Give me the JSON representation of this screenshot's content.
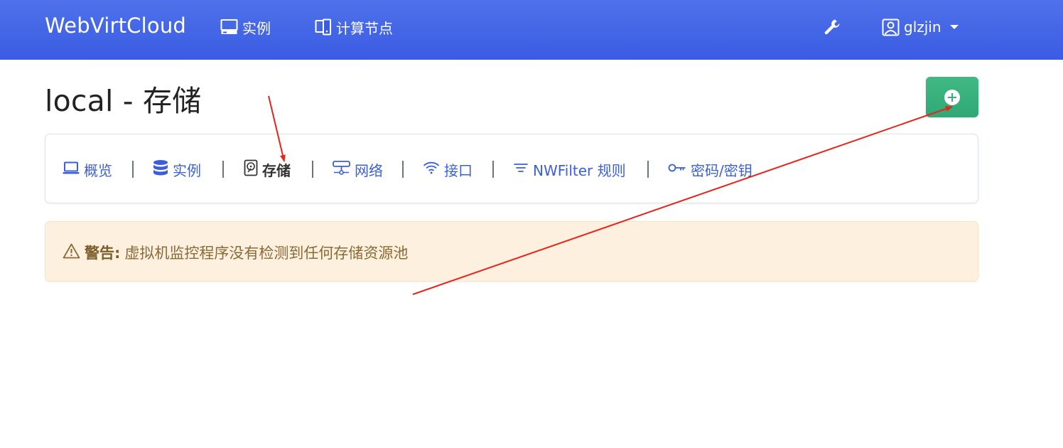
{
  "navbar": {
    "brand": "WebVirtCloud",
    "instances_label": "实例",
    "nodes_label": "计算节点",
    "settings_icon": "wrench-icon",
    "user_name": "glzjin"
  },
  "page": {
    "title": "local - 存储"
  },
  "tabs": [
    {
      "label": "概览",
      "icon": "laptop-icon"
    },
    {
      "label": "实例",
      "icon": "database-icon"
    },
    {
      "label": "存储",
      "icon": "hdd-icon",
      "active": true
    },
    {
      "label": "网络",
      "icon": "network-icon"
    },
    {
      "label": "接口",
      "icon": "wifi-icon"
    },
    {
      "label": "NWFilter 规则",
      "icon": "filter-icon"
    },
    {
      "label": "密码/密钥",
      "icon": "key-icon"
    }
  ],
  "alert": {
    "strong": "警告:",
    "message": "虚拟机监控程序没有检测到任何存储资源池"
  },
  "colors": {
    "navbar": "#3a5be3",
    "add_button": "#37b07b",
    "tab_link": "#3b5fd8",
    "alert_bg": "#fdf0df",
    "annotation_arrow": "#e8231a"
  }
}
